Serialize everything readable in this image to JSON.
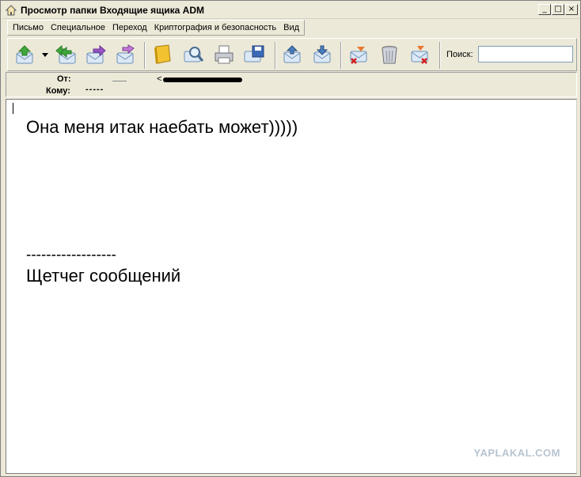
{
  "window": {
    "title": "Просмотр папки Входящие ящика ADM",
    "controls": {
      "minimize": "_",
      "maximize": "□",
      "close": "×"
    }
  },
  "menu": {
    "items": [
      "Письмо",
      "Специальное",
      "Переход",
      "Криптография и безопасность",
      "Вид"
    ]
  },
  "toolbar": {
    "buttons": [
      {
        "name": "receive",
        "icon": "get-mail-icon"
      },
      {
        "name": "reply-all",
        "icon": "reply-all-icon"
      },
      {
        "name": "forward",
        "icon": "forward-icon"
      },
      {
        "name": "redirect",
        "icon": "redirect-icon"
      },
      {
        "name": "address-book",
        "icon": "address-book-icon"
      },
      {
        "name": "find",
        "icon": "find-icon"
      },
      {
        "name": "print",
        "icon": "print-icon"
      },
      {
        "name": "save",
        "icon": "save-icon"
      },
      {
        "name": "previous",
        "icon": "previous-message-icon"
      },
      {
        "name": "next",
        "icon": "next-message-icon"
      },
      {
        "name": "delete",
        "icon": "delete-message-icon"
      },
      {
        "name": "trash",
        "icon": "trash-icon"
      },
      {
        "name": "junk",
        "icon": "junk-icon"
      }
    ],
    "search_label": "Поиск:",
    "search_value": ""
  },
  "header": {
    "from_label": "От:",
    "from_value": "<",
    "to_label": "Кому:",
    "to_value": "-----"
  },
  "message": {
    "line1": "Она меня итак наебать может)))))",
    "separator": "------------------",
    "signature": "Щетчег сообщений"
  },
  "watermark": "YAPLAKAL.COM",
  "colors": {
    "window_bg": "#ece9d8",
    "accent_green": "#3fa83a",
    "accent_blue": "#4a7fc0",
    "accent_purple": "#9a56c4"
  }
}
